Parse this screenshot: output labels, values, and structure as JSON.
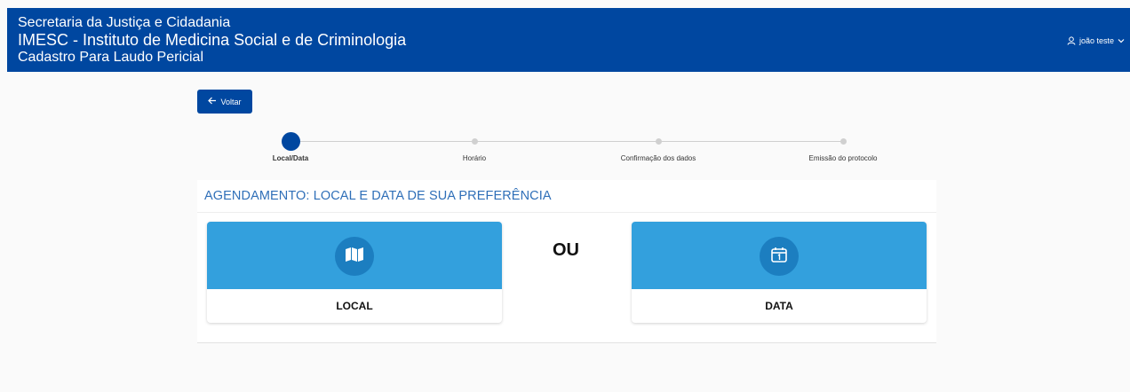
{
  "header": {
    "line1": "Secretaria da Justiça e Cidadania",
    "line2": "IMESC - Instituto de Medicina Social e de Criminologia",
    "line3": "Cadastro Para Laudo Pericial",
    "user_name": "joão teste",
    "icons": [
      "user-icon",
      "chevron-down-icon"
    ]
  },
  "back_button": {
    "label": "Voltar",
    "icon": "arrow-left-icon"
  },
  "stepper": {
    "steps": [
      {
        "label": "Local/Data",
        "active": true
      },
      {
        "label": "Horário",
        "active": false
      },
      {
        "label": "Confirmação dos dados",
        "active": false
      },
      {
        "label": "Emissão do protocolo",
        "active": false
      }
    ]
  },
  "panel": {
    "title": "AGENDAMENTO: LOCAL E DATA DE SUA PREFERÊNCIA",
    "separator": "OU",
    "cards": [
      {
        "label": "LOCAL",
        "icon": "map-icon"
      },
      {
        "label": "DATA",
        "icon": "calendar-icon"
      }
    ]
  },
  "colors": {
    "primary": "#0047a0",
    "card_accent": "#33a0dd",
    "icon_circle": "#1c7ec0",
    "title_text": "#2f6fb8"
  }
}
